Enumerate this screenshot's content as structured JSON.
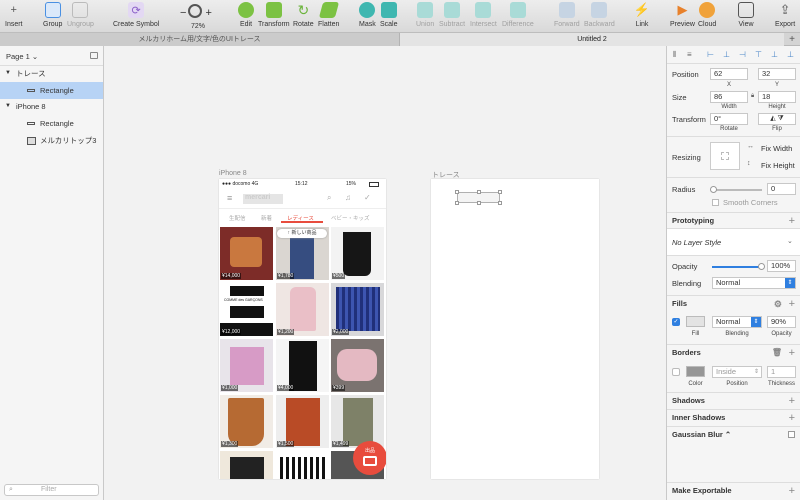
{
  "toolbar": {
    "insert": "Insert",
    "group": "Group",
    "ungroup": "Ungroup",
    "create_symbol": "Create Symbol",
    "zoom": "72%",
    "edit": "Edit",
    "transform": "Transform",
    "rotate": "Rotate",
    "flatten": "Flatten",
    "mask": "Mask",
    "scale": "Scale",
    "union": "Union",
    "subtract": "Subtract",
    "intersect": "Intersect",
    "difference": "Difference",
    "forward": "Forward",
    "backward": "Backward",
    "link": "Link",
    "preview": "Preview",
    "cloud": "Cloud",
    "view": "View",
    "export": "Export",
    "zoom_minus": "−",
    "zoom_plus": "+"
  },
  "tabs": {
    "doc1": "メルカリホーム用/文字/色のUIトレース",
    "doc2": "Untitled 2",
    "plus": "+"
  },
  "layers": {
    "page": "Page 1 ⌄",
    "items": [
      {
        "label": "トレース"
      },
      {
        "label": "Rectangle"
      },
      {
        "label": "iPhone 8"
      },
      {
        "label": "Rectangle"
      },
      {
        "label": "メルカリトップ3"
      }
    ],
    "filter_placeholder": "Filter"
  },
  "canvas": {
    "artboard1_label": "iPhone 8",
    "artboard2_label": "トレース",
    "status": {
      "carrier": "docomo",
      "network": "4G",
      "time": "15:12",
      "battery": "15%"
    },
    "logo": "mercari",
    "tabs": [
      "生配信",
      "新着",
      "レディース",
      "ベビー・キッズ"
    ],
    "new_items_pill": "新しい商品",
    "prices": [
      "¥14,000",
      "¥1,780",
      "¥500",
      "¥12,000",
      "¥1,200",
      "¥2,000",
      "¥1,000",
      "¥4,000",
      "¥399",
      "¥1,300",
      "¥1,500",
      "¥1,499"
    ],
    "brand_text": "COMME des GARÇONS",
    "sell_button": "出品"
  },
  "inspector": {
    "position_label": "Position",
    "x": "62",
    "y": "32",
    "x_sub": "X",
    "y_sub": "Y",
    "size_label": "Size",
    "w": "86",
    "h": "18",
    "w_sub": "Width",
    "h_sub": "Height",
    "transform_label": "Transform",
    "rotate_value": "0°",
    "rotate_sub": "Rotate",
    "flip_sub": "Flip",
    "resizing_label": "Resizing",
    "fix_width": "Fix Width",
    "fix_height": "Fix Height",
    "radius_label": "Radius",
    "radius_value": "0",
    "smooth_corners": "Smooth Corners",
    "prototyping": "Prototyping",
    "layer_style": "No Layer Style",
    "opacity_label": "Opacity",
    "opacity_value": "100%",
    "opacity_level": 1.0,
    "blending_label": "Blending",
    "blending_value": "Normal",
    "fills": "Fills",
    "fill_blend": "Normal",
    "fill_opacity": "90%",
    "fill_sub": "Fill",
    "blending_sub": "Blending",
    "opacity_sub": "Opacity",
    "borders": "Borders",
    "border_position": "Inside",
    "border_thickness": "1",
    "color_sub": "Color",
    "position_sub": "Position",
    "thickness_sub": "Thickness",
    "shadows": "Shadows",
    "inner_shadows": "Inner Shadows",
    "gaussian_blur": "Gaussian Blur ⌃",
    "make_exportable": "Make Exportable"
  },
  "colors": {
    "accent": "#2f7fe0",
    "selection": "#b7d3f5",
    "mercari_red": "#e84c3d"
  }
}
